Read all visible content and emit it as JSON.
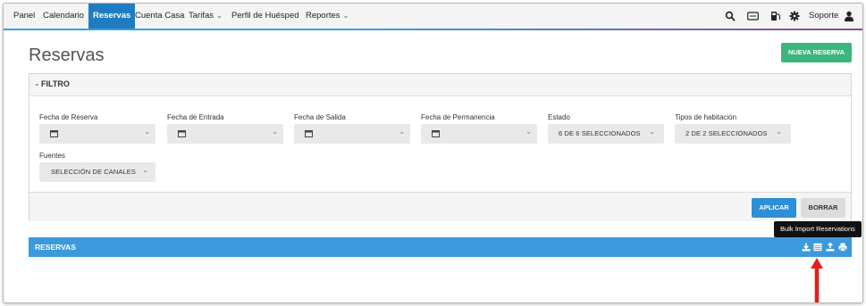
{
  "nav": {
    "items": [
      {
        "label": "Panel",
        "active": false,
        "dropdown": false
      },
      {
        "label": "Calendario",
        "active": false,
        "dropdown": false
      },
      {
        "label": "Reservas",
        "active": true,
        "dropdown": false
      },
      {
        "label": "Cuenta Casa",
        "active": false,
        "dropdown": false
      },
      {
        "label": "Tarifas",
        "active": false,
        "dropdown": true
      },
      {
        "label": "Perfil de Huésped",
        "active": false,
        "dropdown": false
      },
      {
        "label": "Reportes",
        "active": false,
        "dropdown": true
      }
    ],
    "right": {
      "icons": [
        "search-icon",
        "card-icon",
        "fuel-pump-icon",
        "gear-icon",
        "user-icon"
      ],
      "support_label": "Soporte"
    }
  },
  "page": {
    "title": "Reservas",
    "new_button": "NUEVA RESERVA"
  },
  "filter": {
    "title": "FILTRO",
    "fields": [
      {
        "label": "Fecha de Reserva",
        "value": "",
        "type": "date"
      },
      {
        "label": "Fecha de Entrada",
        "value": "",
        "type": "date"
      },
      {
        "label": "Fecha de Salida",
        "value": "",
        "type": "date"
      },
      {
        "label": "Fecha de Permanencia",
        "value": "",
        "type": "date"
      },
      {
        "label": "Estado",
        "value": "6 DE 6 SELECCIONADOS",
        "type": "select"
      },
      {
        "label": "Tipos de habitación",
        "value": "2 DE 2 SELECCIONADOS",
        "type": "select"
      },
      {
        "label": "Fuentes",
        "value": "SELECCIÓN DE CANALES",
        "type": "select"
      }
    ],
    "apply_button": "APLICAR",
    "clear_button": "BORRAR"
  },
  "reservations": {
    "title": "RESERVAS",
    "toolbar_icons": [
      "download-icon",
      "bulk-import-icon",
      "upload-icon",
      "print-icon"
    ],
    "tooltip": "Bulk Import Reservations"
  },
  "colors": {
    "accent": "#1f7cc0",
    "bar": "#3c99dc",
    "green": "#3bb77e",
    "arrow": "#e0201b"
  }
}
